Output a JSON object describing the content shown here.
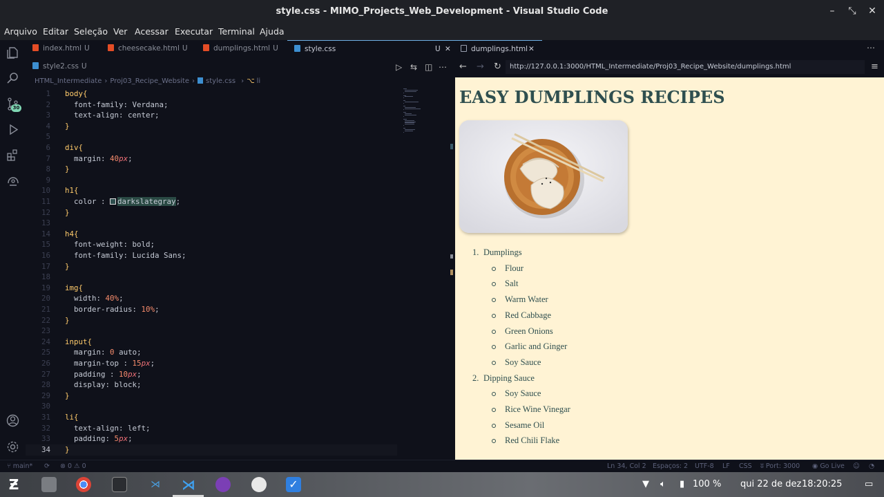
{
  "window": {
    "title": "style.css - MIMO_Projects_Web_Development - Visual Studio Code"
  },
  "menu": [
    "Arquivo",
    "Editar",
    "Seleção",
    "Ver",
    "Acessar",
    "Executar",
    "Terminal",
    "Ajuda"
  ],
  "activity_badge": "30",
  "tabs_left": [
    {
      "label": "index.html",
      "mod": "U"
    },
    {
      "label": "cheesecake.html",
      "mod": "U"
    },
    {
      "label": "dumplings.html",
      "mod": "U"
    },
    {
      "label": "style.css",
      "mod": "U"
    }
  ],
  "tab_second_row": {
    "label": "style2.css",
    "mod": "U"
  },
  "breadcrumb": [
    "HTML_Intermediate",
    "›",
    "Proj03_Recipe_Website",
    "›",
    "style.css",
    "›",
    "li"
  ],
  "code_lines": [
    "body{",
    "  font-family: Verdana;",
    "  text-align: center;",
    "}",
    "",
    "div{",
    "  margin: 40px;",
    "}",
    "",
    "h1{",
    "  color : darkslategray;",
    "}",
    "",
    "h4{",
    "  font-weight: bold;",
    "  font-family: Lucida Sans;",
    "}",
    "",
    "img{",
    "  width: 40%;",
    "  border-radius: 10%;",
    "}",
    "",
    "input{",
    "  margin: 0 auto;",
    "  margin-top : 15px;",
    "  padding : 10px;",
    "  display: block;",
    "}",
    "",
    "li{",
    "  text-align: left;",
    "  padding: 5px;",
    "}"
  ],
  "tabs_right": [
    {
      "label": "dumplings.html"
    }
  ],
  "browser": {
    "url": "http://127.0.0.1:3000/HTML_Intermediate/Proj03_Recipe_Website/dumplings.html"
  },
  "preview": {
    "heading": "EASY DUMPLINGS RECIPES",
    "list": [
      {
        "num": "1.",
        "title": "Dumplings",
        "items": [
          "Flour",
          "Salt",
          "Warm Water",
          "Red Cabbage",
          "Green Onions",
          "Garlic and Ginger",
          "Soy Sauce"
        ]
      },
      {
        "num": "2.",
        "title": "Dipping Sauce",
        "items": [
          "Soy Sauce",
          "Rice Wine Vinegar",
          "Sesame Oil",
          "Red Chili Flake"
        ]
      }
    ]
  },
  "status": {
    "branch": "main*",
    "problems": "⊗ 0 ⚠ 0",
    "position": "Ln 34, Col 2",
    "spaces": "Espaços: 2",
    "encoding": "UTF-8",
    "eol": "LF",
    "language": "CSS",
    "port": "Port: 3000",
    "golive": "Go Live"
  },
  "taskbar": {
    "volume": "100 %",
    "date": "qui 22 de dez",
    "time": "18:20:25"
  },
  "colors": {
    "accent": "#6fb0e6",
    "preview_bg": "#fff3d4",
    "heading": "#2f4f4f"
  }
}
